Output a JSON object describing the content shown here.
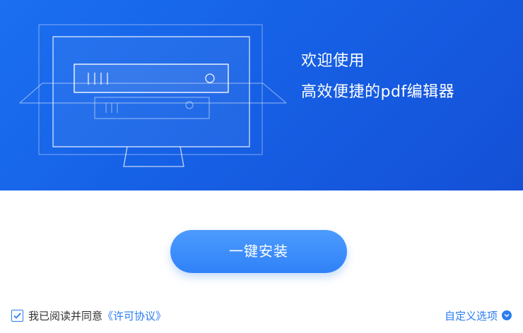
{
  "banner": {
    "welcome": "欢迎使用",
    "tagline": "高效便捷的pdf编辑器"
  },
  "install": {
    "label": "一键安装"
  },
  "agreement": {
    "checked": true,
    "text": "我已阅读并同意",
    "link": "《许可协议》"
  },
  "options": {
    "label": "自定义选项"
  },
  "colors": {
    "banner": "#1661e6",
    "accent": "#2a7cf0",
    "button": "#3a8bf9"
  }
}
